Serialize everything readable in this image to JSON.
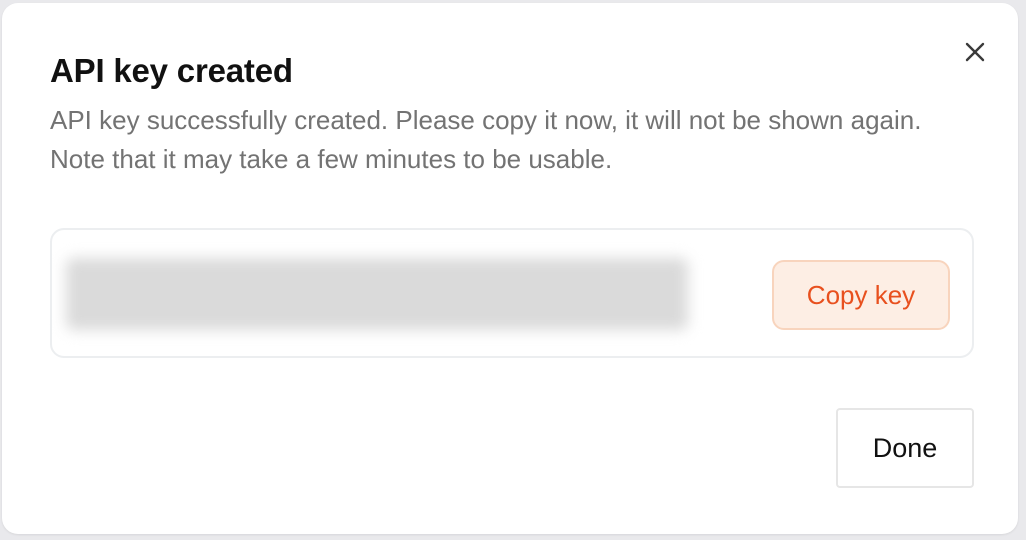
{
  "dialog": {
    "title": "API key created",
    "description": "API key successfully created. Please copy it now, it will not be shown again. Note that it may take a few minutes to be usable.",
    "close_icon": "close-icon",
    "key_value": "",
    "copy_label": "Copy key",
    "done_label": "Done"
  },
  "colors": {
    "accent": "#e8501e",
    "accent_bg": "#fdeee4",
    "accent_border": "#f8d4bd",
    "muted_text": "#737373",
    "title_text": "#111111"
  }
}
